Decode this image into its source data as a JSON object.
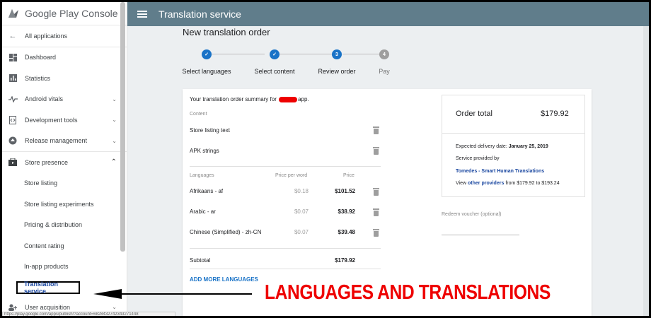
{
  "app": {
    "brand": "Google Play Console"
  },
  "topbar": {
    "title": "Translation service"
  },
  "sidebar": {
    "back": "All applications",
    "items": [
      {
        "label": "Dashboard",
        "icon": "dashboard-icon"
      },
      {
        "label": "Statistics",
        "icon": "statistics-icon"
      },
      {
        "label": "Android vitals",
        "icon": "vitals-icon"
      },
      {
        "label": "Development tools",
        "icon": "dev-tools-icon"
      },
      {
        "label": "Release management",
        "icon": "release-icon"
      },
      {
        "label": "Store presence",
        "icon": "store-icon"
      }
    ],
    "sub_items": [
      "Store listing",
      "Store listing experiments",
      "Pricing & distribution",
      "Content rating",
      "In-app products"
    ],
    "active": "Translation service",
    "next": "User acquisition"
  },
  "status_url": "https://play.google.com/apps/publish/?account=6828432742343271448",
  "page": {
    "title": "New translation order"
  },
  "steps": [
    {
      "label": "Select languages",
      "num": ""
    },
    {
      "label": "Select content",
      "num": ""
    },
    {
      "label": "Review order",
      "num": "3"
    },
    {
      "label": "Pay",
      "num": "4"
    }
  ],
  "summary": {
    "prefix": "Your translation order summary for",
    "suffix": "app."
  },
  "content_section": {
    "header": "Content",
    "items": [
      "Store listing text",
      "APK strings"
    ]
  },
  "languages_section": {
    "headers": {
      "language": "Languages",
      "ppw": "Price per word",
      "price": "Price"
    },
    "rows": [
      {
        "name": "Afrikaans - af",
        "ppw": "$0.18",
        "price": "$101.52"
      },
      {
        "name": "Arabic - ar",
        "ppw": "$0.07",
        "price": "$38.92"
      },
      {
        "name": "Chinese (Simplified) - zh-CN",
        "ppw": "$0.07",
        "price": "$39.48"
      }
    ],
    "subtotal_label": "Subtotal",
    "subtotal": "$179.92",
    "add_more": "ADD MORE LANGUAGES"
  },
  "order": {
    "label": "Order total",
    "total": "$179.92",
    "delivery_prefix": "Expected delivery date:",
    "delivery_date": "January 25, 2019",
    "provider_prefix": "Service provided by",
    "provider": "Tomedes - Smart Human Translations",
    "view": "View",
    "other": "other providers",
    "range": "from $179.92 to $193.24"
  },
  "voucher": {
    "label": "Redeem voucher (optional)"
  },
  "annotation": {
    "text": "LANGUAGES AND TRANSLATIONS"
  },
  "colors": {
    "topbar": "#607d8b",
    "accent": "#1a73c7",
    "annotation": "#ee0000"
  }
}
